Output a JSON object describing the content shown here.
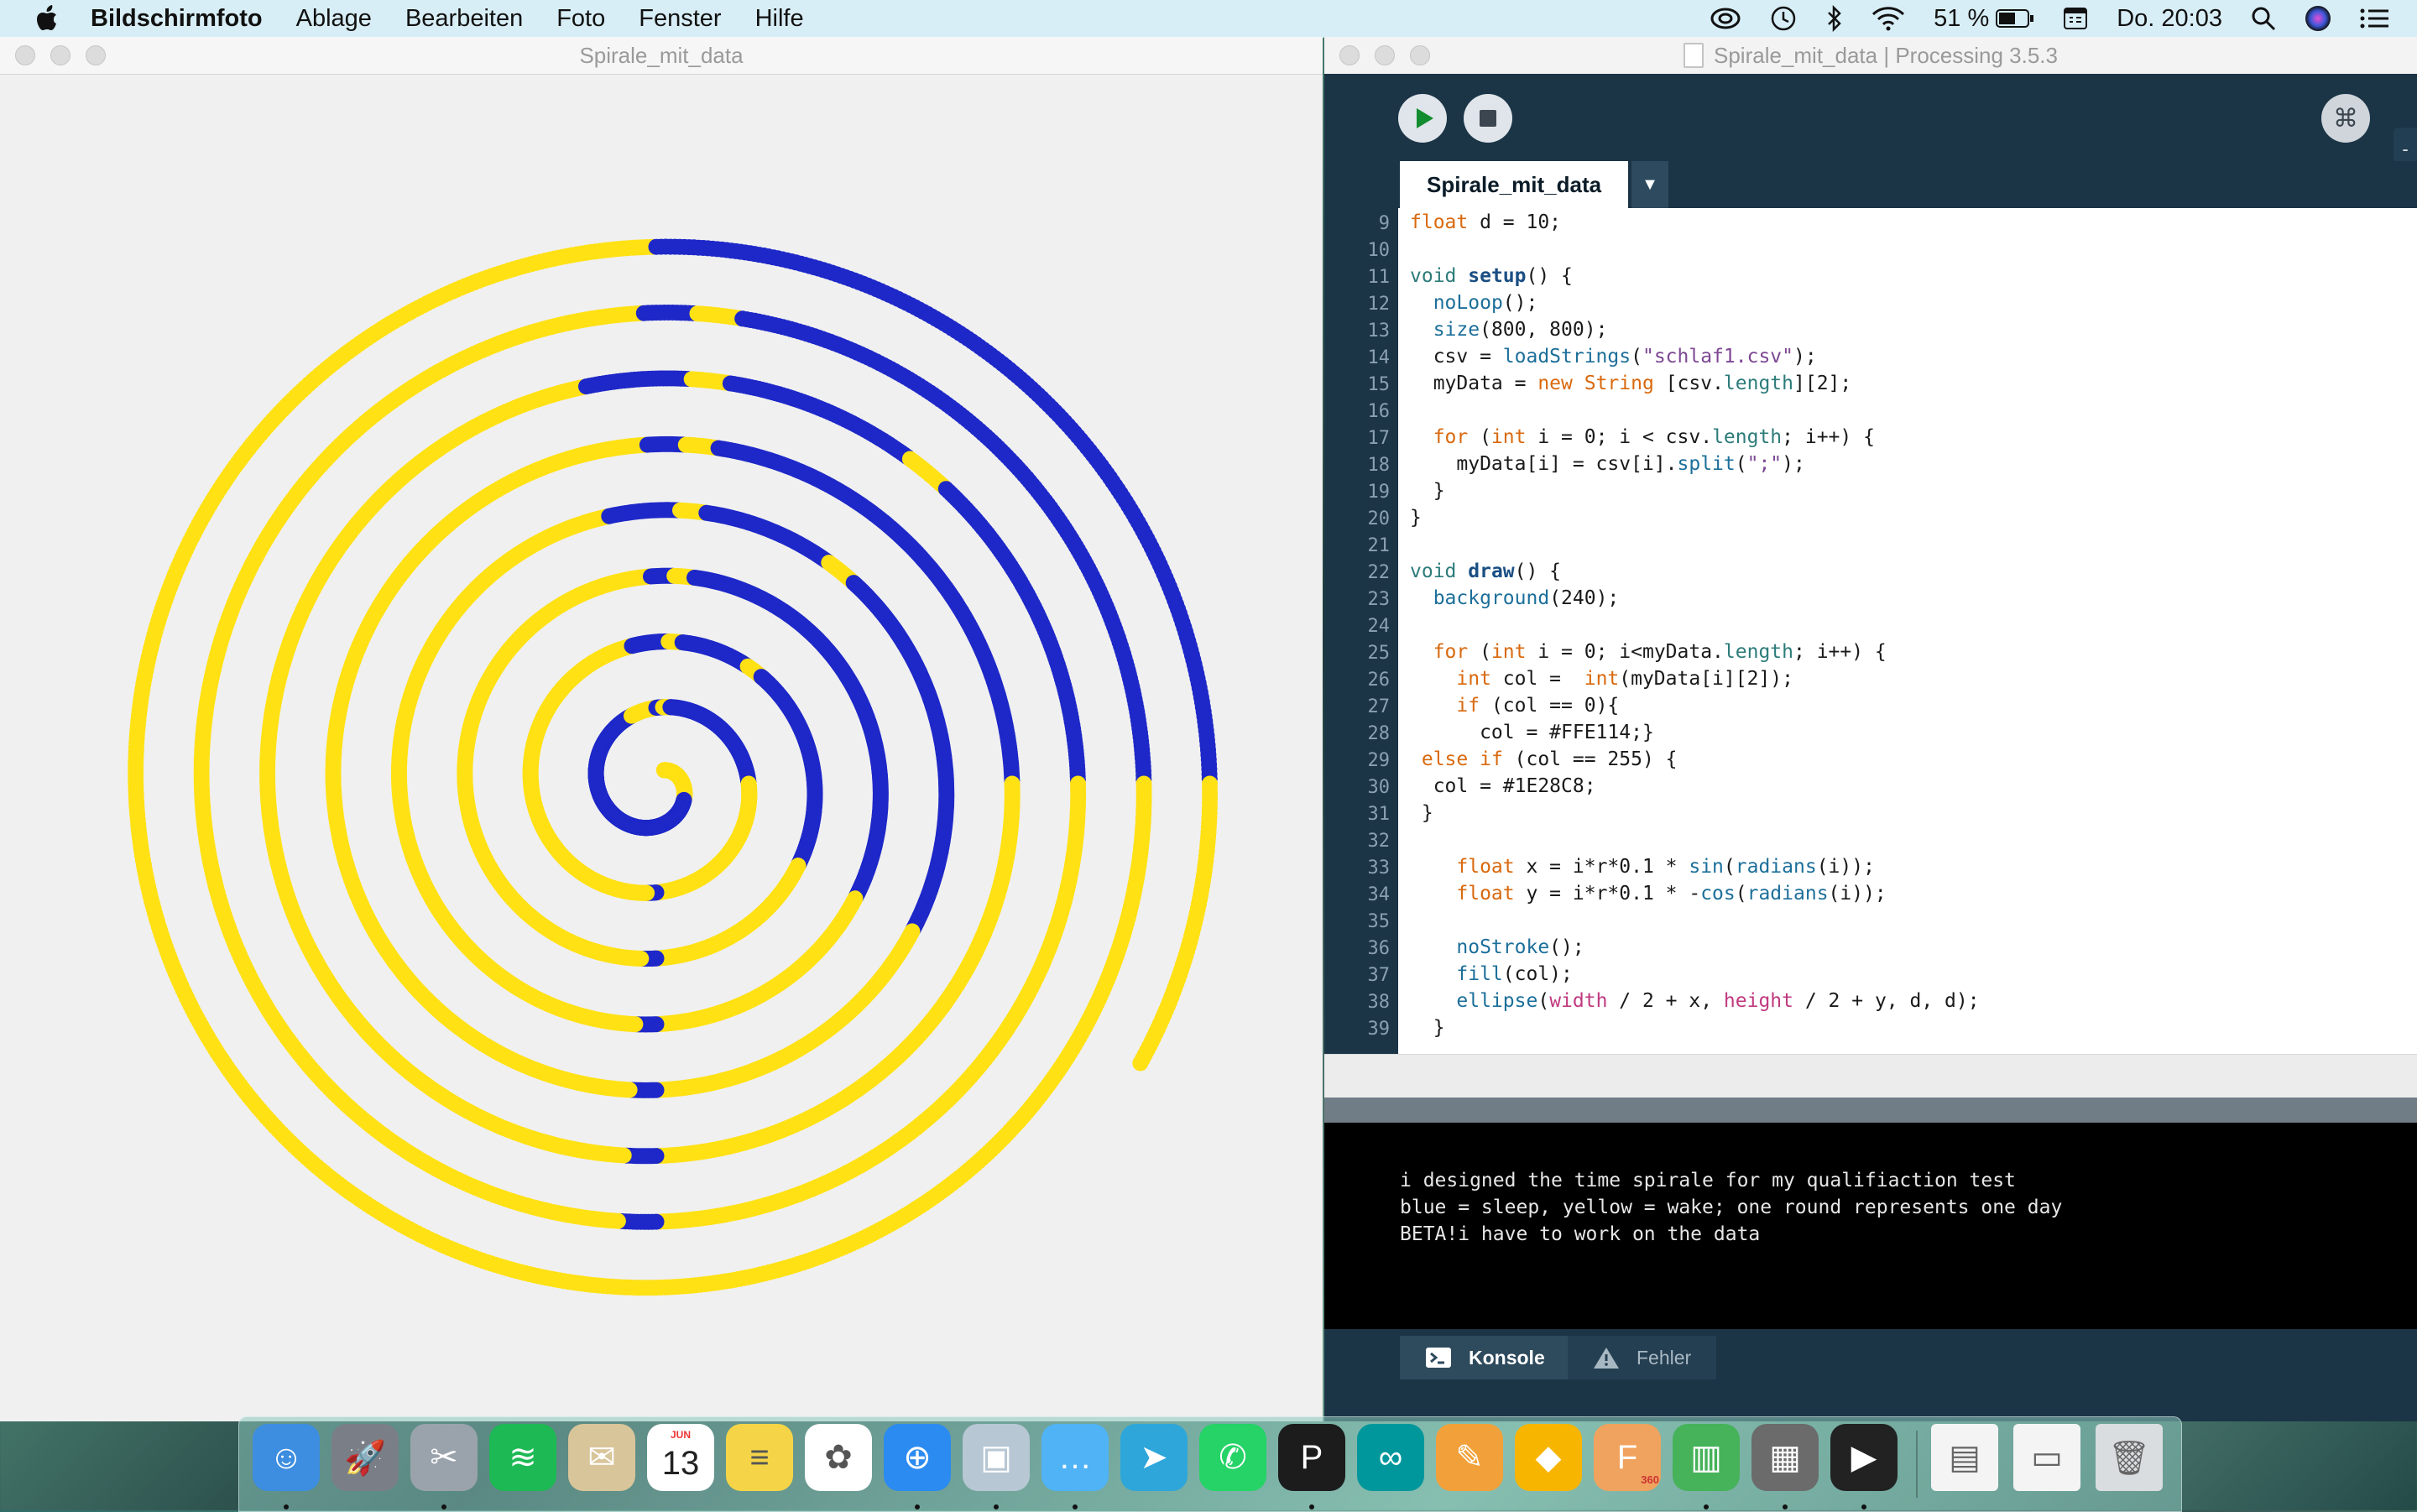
{
  "menubar": {
    "app_name": "Bildschirmfoto",
    "items": [
      "Ablage",
      "Bearbeiten",
      "Foto",
      "Fenster",
      "Hilfe"
    ],
    "battery": "51 %",
    "clock": "Do. 20:03"
  },
  "sketch_window": {
    "title": "Spirale_mit_data",
    "spiral": {
      "background": "#F0F0F0",
      "colors": {
        "wake": "#FFE114",
        "sleep": "#1E28C8"
      },
      "dot_diameter": 10
    }
  },
  "ide": {
    "title": "Spirale_mit_data | Processing 3.5.3",
    "tab_label": "Spirale_mit_data",
    "tab_menu_glyph": "▼",
    "side_glyph": "-",
    "mode_glyph": "⌘",
    "code_lines": [
      {
        "n": "9",
        "html": "<span class=\"kw\">float</span> d = 10;"
      },
      {
        "n": "10",
        "html": ""
      },
      {
        "n": "11",
        "html": "<span class=\"kw2\">void</span> <span class=\"fnb\">setup</span>() {"
      },
      {
        "n": "12",
        "html": "  <span class=\"fn\">noLoop</span>();"
      },
      {
        "n": "13",
        "html": "  <span class=\"fn\">size</span>(800, 800);"
      },
      {
        "n": "14",
        "html": "  csv = <span class=\"fn\">loadStrings</span>(<span class=\"str\">\"schlaf1.csv\"</span>);"
      },
      {
        "n": "15",
        "html": "  myData = <span class=\"kw\">new</span> <span class=\"kw\">String</span> [csv.<span class=\"kw2\">length</span>][2];"
      },
      {
        "n": "16",
        "html": ""
      },
      {
        "n": "17",
        "html": "  <span class=\"kw\">for</span> (<span class=\"kw\">int</span> i = 0; i &lt; csv.<span class=\"kw2\">length</span>; i++) {"
      },
      {
        "n": "18",
        "html": "    myData[i] = csv[i].<span class=\"fn\">split</span>(<span class=\"str\">\";\"</span>);"
      },
      {
        "n": "19",
        "html": "  }"
      },
      {
        "n": "20",
        "html": "}"
      },
      {
        "n": "21",
        "html": ""
      },
      {
        "n": "22",
        "html": "<span class=\"kw2\">void</span> <span class=\"fnb\">draw</span>() {"
      },
      {
        "n": "23",
        "html": "  <span class=\"fn\">background</span>(240);"
      },
      {
        "n": "24",
        "html": ""
      },
      {
        "n": "25",
        "html": "  <span class=\"kw\">for</span> (<span class=\"kw\">int</span> i = 0; i&lt;myData.<span class=\"kw2\">length</span>; i++) {"
      },
      {
        "n": "26",
        "html": "    <span class=\"kw\">int</span> col =  <span class=\"kw\">int</span>(myData[i][2]);"
      },
      {
        "n": "27",
        "html": "    <span class=\"kw\">if</span> (col == 0){"
      },
      {
        "n": "28",
        "html": "      col = #FFE114;}"
      },
      {
        "n": "29",
        "html": " <span class=\"kw\">else</span> <span class=\"kw\">if</span> (col == 255) {"
      },
      {
        "n": "30",
        "html": "  col = #1E28C8;"
      },
      {
        "n": "31",
        "html": " }"
      },
      {
        "n": "32",
        "html": ""
      },
      {
        "n": "33",
        "html": "    <span class=\"kw\">float</span> x = i*r*0.1 * <span class=\"fn\">sin</span>(<span class=\"fn\">radians</span>(i));"
      },
      {
        "n": "34",
        "html": "    <span class=\"kw\">float</span> y = i*r*0.1 * -<span class=\"fn\">cos</span>(<span class=\"fn\">radians</span>(i));"
      },
      {
        "n": "35",
        "html": ""
      },
      {
        "n": "36",
        "html": "    <span class=\"fn\">noStroke</span>();"
      },
      {
        "n": "37",
        "html": "    <span class=\"fn\">fill</span>(col);"
      },
      {
        "n": "38",
        "html": "    <span class=\"fn\">ellipse</span>(<span class=\"var\">width</span> / 2 + x, <span class=\"var\">height</span> / 2 + y, d, d);"
      },
      {
        "n": "39",
        "html": "  }"
      }
    ],
    "console_lines": [
      "i designed the time spirale for my qualifiaction test",
      "blue = sleep, yellow = wake; one round represents one day",
      "BETA!i have to work on the data"
    ],
    "console_tabs": {
      "console": "Konsole",
      "errors": "Fehler"
    }
  },
  "dock": {
    "calendar_month": "JUN",
    "calendar_day": "13",
    "fusion_badge": "360",
    "apps": [
      {
        "name": "finder-icon",
        "color": "#3d8de0",
        "glyph": "☺",
        "dot": true
      },
      {
        "name": "launchpad-icon",
        "color": "#7a7f87",
        "glyph": "🚀",
        "dot": false
      },
      {
        "name": "screenshot-icon",
        "color": "#9aa3ab",
        "glyph": "✂",
        "dot": true
      },
      {
        "name": "spotify-icon",
        "color": "#1db954",
        "glyph": "≋",
        "dot": false
      },
      {
        "name": "mail-icon",
        "color": "#d9c59a",
        "glyph": "✉",
        "dot": false
      },
      {
        "name": "calendar-icon",
        "color": "#ffffff",
        "glyph": "",
        "dot": false
      },
      {
        "name": "notes-icon",
        "color": "#f5d547",
        "glyph": "≡",
        "dot": false
      },
      {
        "name": "photos-icon",
        "color": "#ffffff",
        "glyph": "✿",
        "dot": false
      },
      {
        "name": "safari-icon",
        "color": "#2b8bf0",
        "glyph": "⊕",
        "dot": true
      },
      {
        "name": "preview-icon",
        "color": "#b7c7d3",
        "glyph": "▣",
        "dot": true
      },
      {
        "name": "messages-icon",
        "color": "#4fb3f5",
        "glyph": "…",
        "dot": true
      },
      {
        "name": "telegram-icon",
        "color": "#2ea6da",
        "glyph": "➤",
        "dot": false
      },
      {
        "name": "whatsapp-icon",
        "color": "#25d366",
        "glyph": "✆",
        "dot": false
      },
      {
        "name": "processing-icon",
        "color": "#1c1c1c",
        "glyph": "P",
        "dot": true
      },
      {
        "name": "arduino-icon",
        "color": "#00979c",
        "glyph": "∞",
        "dot": false
      },
      {
        "name": "pages-icon",
        "color": "#f2a13a",
        "glyph": "✎",
        "dot": false
      },
      {
        "name": "sketch-icon",
        "color": "#f7b500",
        "glyph": "◆",
        "dot": false
      },
      {
        "name": "fusion360-icon",
        "color": "#f0a35e",
        "glyph": "F",
        "dot": false
      },
      {
        "name": "numbers-icon",
        "color": "#46b25a",
        "glyph": "▥",
        "dot": true
      },
      {
        "name": "calculator-icon",
        "color": "#6b6b6b",
        "glyph": "▦",
        "dot": true
      },
      {
        "name": "quicktime-icon",
        "color": "#222222",
        "glyph": "▶",
        "dot": true
      }
    ],
    "right_items": [
      {
        "name": "document-stack-icon",
        "color": "#f4f4f4",
        "glyph": "▤"
      },
      {
        "name": "downloads-stack-icon",
        "color": "#f4f4f4",
        "glyph": "▭"
      },
      {
        "name": "trash-icon",
        "color": "#d9dde0",
        "glyph": "🗑"
      }
    ]
  }
}
